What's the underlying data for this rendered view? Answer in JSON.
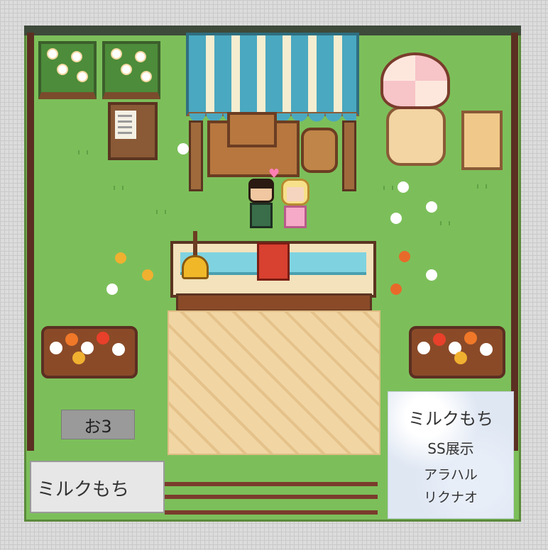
{
  "booth": {
    "number_plate": "お3",
    "circle_name_plate": "ミルクもち",
    "info_card": {
      "title": "ミルクもち",
      "subtitle": "SS展示",
      "line1": "アラハル",
      "line2": "リクナオ"
    }
  },
  "colors": {
    "grass": "#7cbf5a",
    "awning_blue": "#4aa8c0",
    "awning_cream": "#f5edd0",
    "carpet": "#f1d6a4",
    "counter_glass": "#7fd3e0"
  },
  "icons": [
    "heart-icon",
    "bell-icon",
    "book-icon",
    "umbrella-icon"
  ]
}
